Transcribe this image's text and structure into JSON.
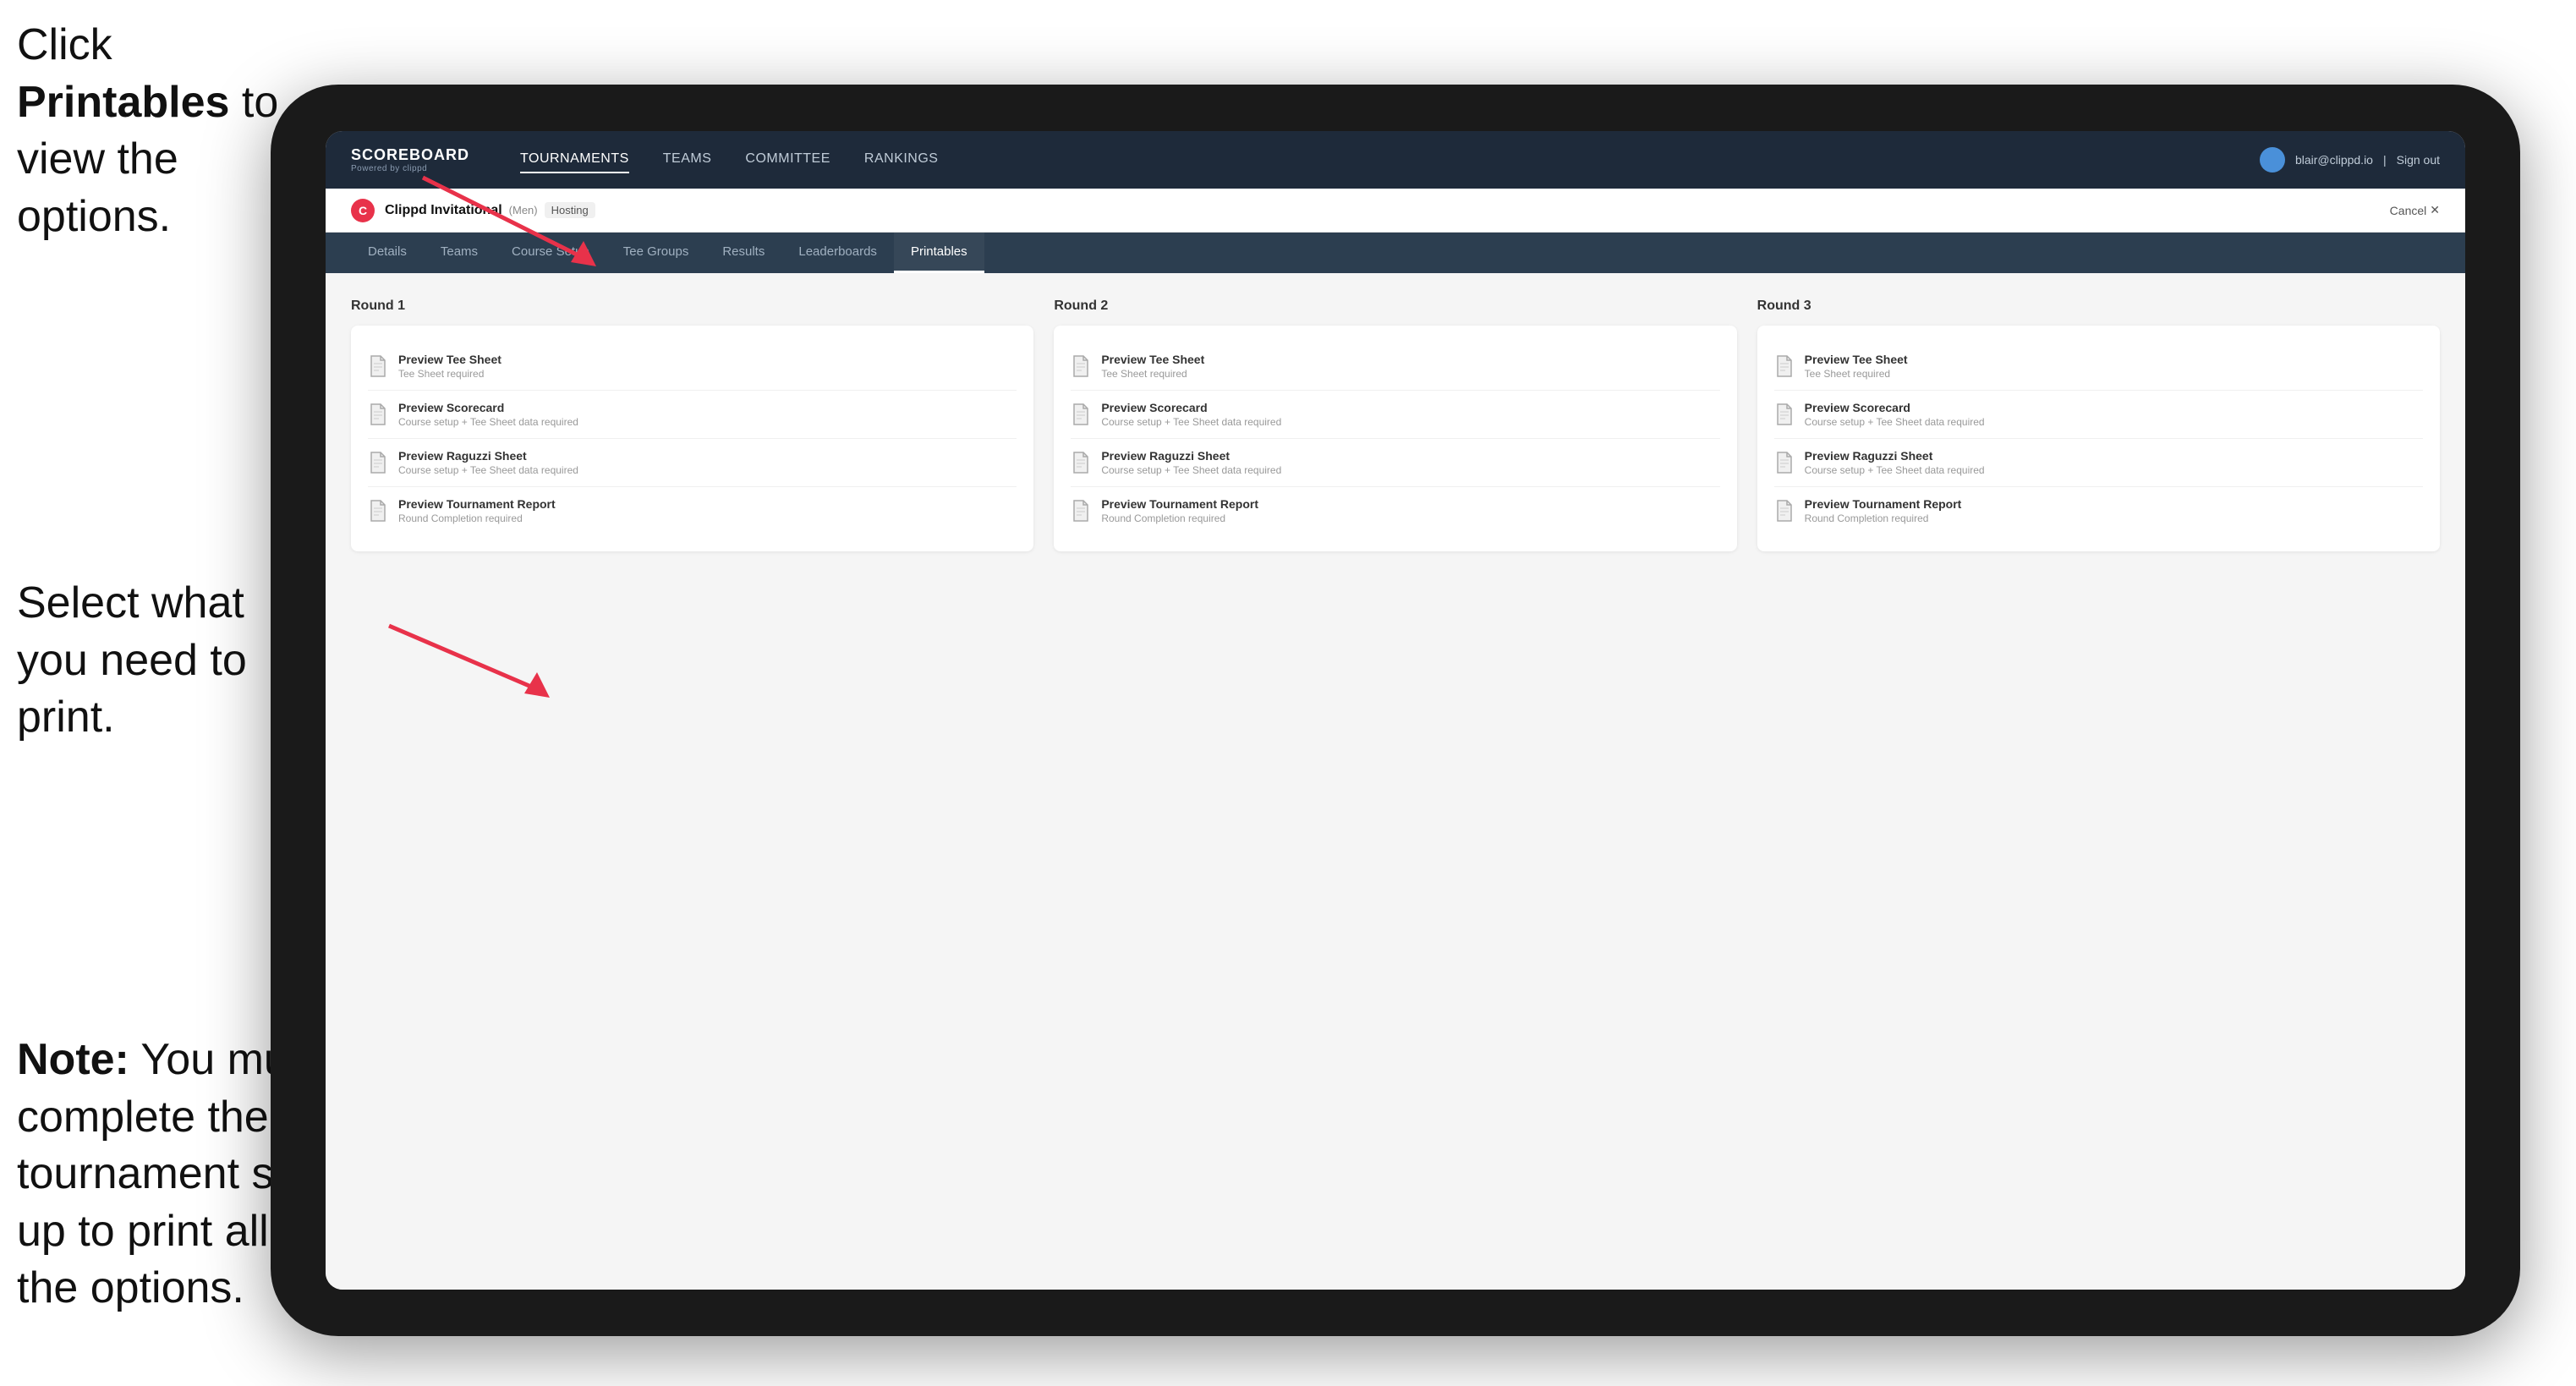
{
  "instructions": {
    "top_line1": "Click ",
    "top_bold": "Printables",
    "top_line2": " to",
    "top_line3": "view the options.",
    "mid_line1": "Select what you",
    "mid_line2": "need to print.",
    "bot_note": "Note:",
    "bot_text": " You must complete the tournament set-up to print all the options."
  },
  "navbar": {
    "brand_title": "SCOREBOARD",
    "brand_sub": "Powered by clippd",
    "nav_items": [
      {
        "label": "TOURNAMENTS",
        "active": true
      },
      {
        "label": "TEAMS",
        "active": false
      },
      {
        "label": "COMMITTEE",
        "active": false
      },
      {
        "label": "RANKINGS",
        "active": false
      }
    ],
    "user_email": "blair@clippd.io",
    "separator": "|",
    "sign_out": "Sign out"
  },
  "tournament_bar": {
    "logo_letter": "C",
    "tournament_name": "Clippd Invitational",
    "gender_badge": "(Men)",
    "hosting_label": "Hosting",
    "cancel_label": "Cancel",
    "cancel_icon": "✕"
  },
  "sub_tabs": [
    {
      "label": "Details",
      "active": false
    },
    {
      "label": "Teams",
      "active": false
    },
    {
      "label": "Course Setup",
      "active": false
    },
    {
      "label": "Tee Groups",
      "active": false
    },
    {
      "label": "Results",
      "active": false
    },
    {
      "label": "Leaderboards",
      "active": false
    },
    {
      "label": "Printables",
      "active": true
    }
  ],
  "rounds": [
    {
      "title": "Round 1",
      "items": [
        {
          "title": "Preview Tee Sheet",
          "sub": "Tee Sheet required"
        },
        {
          "title": "Preview Scorecard",
          "sub": "Course setup + Tee Sheet data required"
        },
        {
          "title": "Preview Raguzzi Sheet",
          "sub": "Course setup + Tee Sheet data required"
        },
        {
          "title": "Preview Tournament Report",
          "sub": "Round Completion required"
        }
      ]
    },
    {
      "title": "Round 2",
      "items": [
        {
          "title": "Preview Tee Sheet",
          "sub": "Tee Sheet required"
        },
        {
          "title": "Preview Scorecard",
          "sub": "Course setup + Tee Sheet data required"
        },
        {
          "title": "Preview Raguzzi Sheet",
          "sub": "Course setup + Tee Sheet data required"
        },
        {
          "title": "Preview Tournament Report",
          "sub": "Round Completion required"
        }
      ]
    },
    {
      "title": "Round 3",
      "items": [
        {
          "title": "Preview Tee Sheet",
          "sub": "Tee Sheet required"
        },
        {
          "title": "Preview Scorecard",
          "sub": "Course setup + Tee Sheet data required"
        },
        {
          "title": "Preview Raguzzi Sheet",
          "sub": "Course setup + Tee Sheet data required"
        },
        {
          "title": "Preview Tournament Report",
          "sub": "Round Completion required"
        }
      ]
    }
  ]
}
